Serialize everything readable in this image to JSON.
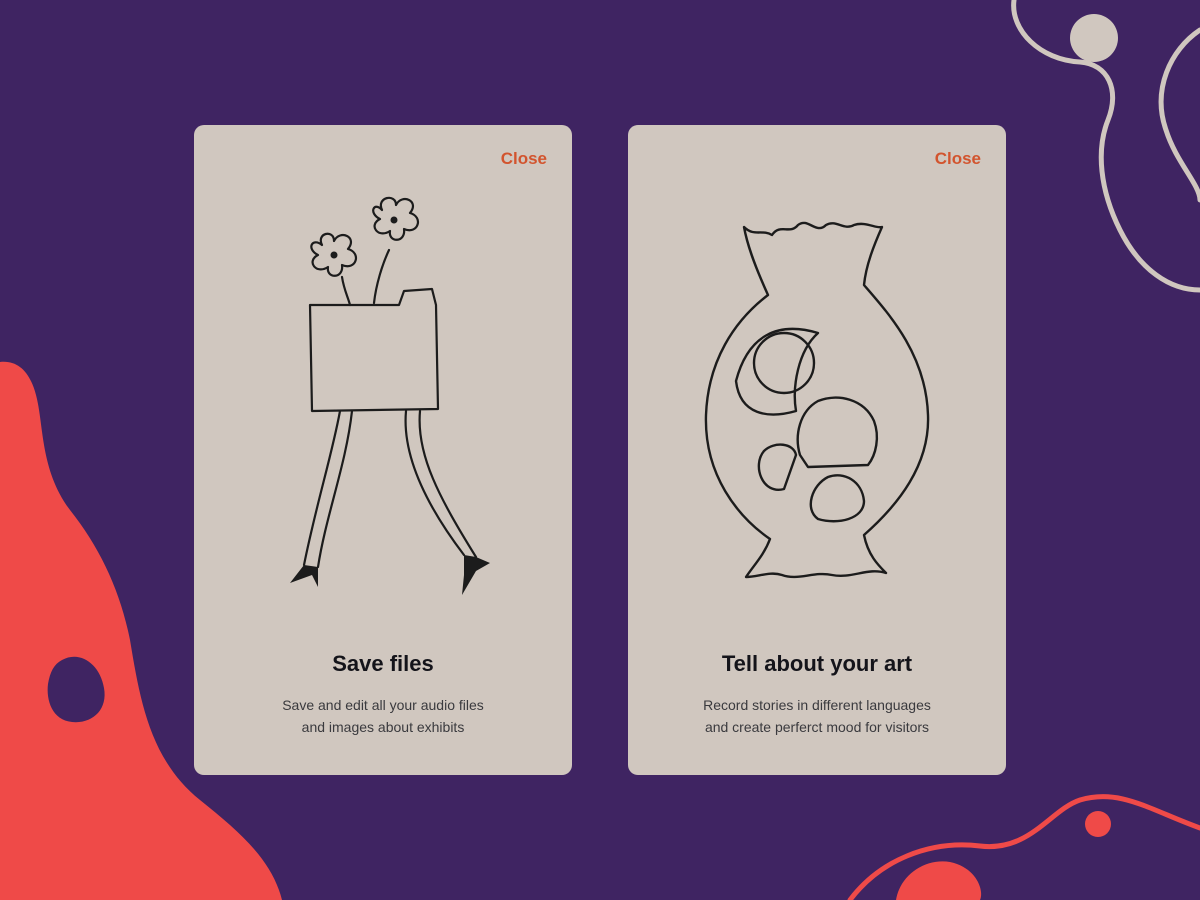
{
  "colors": {
    "background": "#3f2462",
    "card": "#d0c7bf",
    "accent": "#d2542e",
    "blob": "#ef4a48",
    "line": "#d0c7bf",
    "ink": "#14141a"
  },
  "cards": [
    {
      "close_label": "Close",
      "illustration": "flowers-in-walking-folder-icon",
      "title": "Save files",
      "description_lines": [
        "Save and edit all your audio files",
        "and images about exhibits"
      ]
    },
    {
      "close_label": "Close",
      "illustration": "vase-icon",
      "title": "Tell about your art",
      "description_lines": [
        "Record stories in different languages",
        "and create perferct mood for visitors"
      ]
    }
  ]
}
